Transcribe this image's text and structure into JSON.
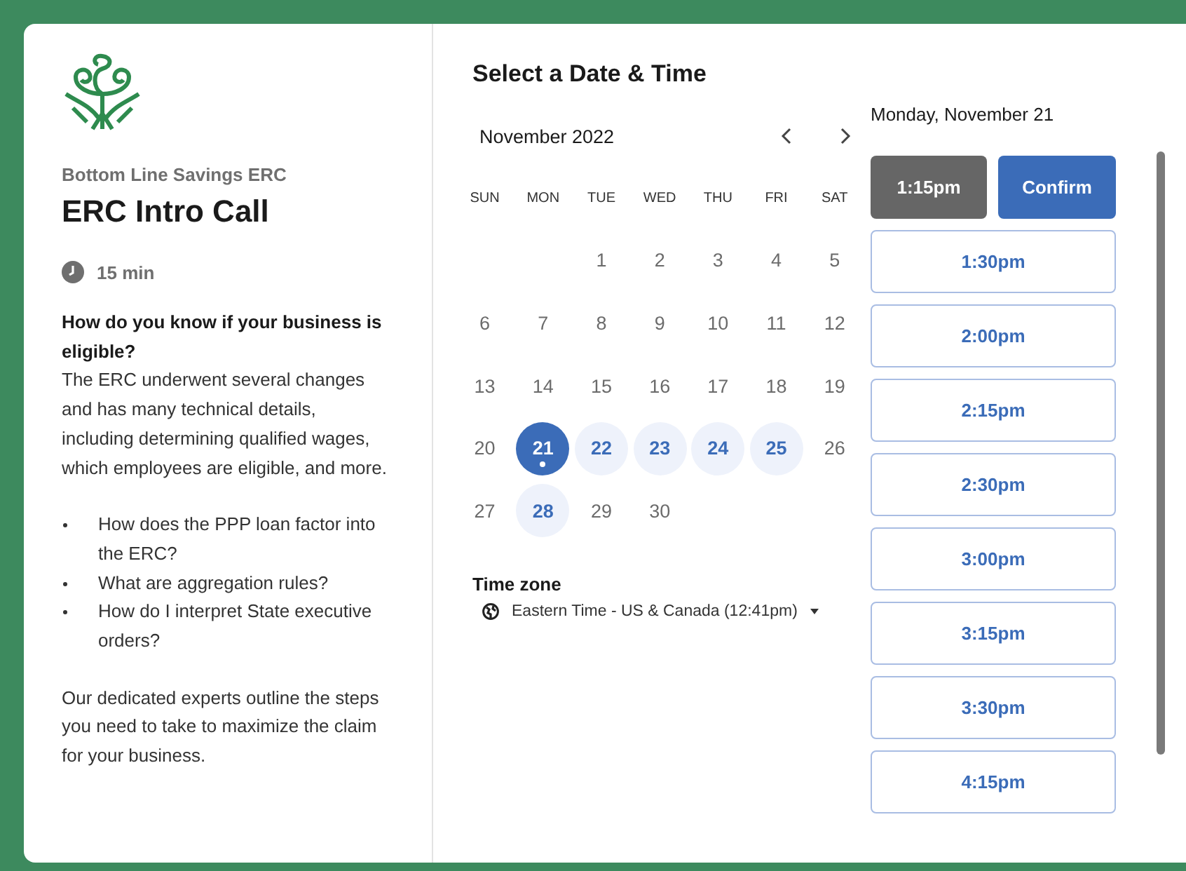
{
  "organizer": "Bottom Line Savings ERC",
  "event_title": "ERC Intro Call",
  "duration": "15 min",
  "description": {
    "heading": "How do you know if your business is eligible?",
    "intro": "The ERC underwent several changes and has many technical details, including determining qualified wages, which employees are eligible, and more.",
    "bullets": [
      "How does the PPP loan factor into the ERC?",
      "What are aggregation rules?",
      "How do I interpret State executive orders?"
    ],
    "closing": "Our dedicated experts outline the steps you need to take to maximize the claim for your business."
  },
  "scheduler": {
    "heading": "Select a Date & Time",
    "month": "November 2022",
    "weekdays": [
      "SUN",
      "MON",
      "TUE",
      "WED",
      "THU",
      "FRI",
      "SAT"
    ],
    "weeks": [
      [
        {
          "label": "1",
          "available": false,
          "selected": false,
          "today": false
        },
        {
          "label": "2",
          "available": false,
          "selected": false,
          "today": false
        },
        {
          "label": "3",
          "available": false,
          "selected": false,
          "today": false
        },
        {
          "label": "4",
          "available": false,
          "selected": false,
          "today": false
        },
        {
          "label": "5",
          "available": false,
          "selected": false,
          "today": false
        }
      ],
      [
        {
          "label": "6",
          "available": false,
          "selected": false,
          "today": false
        },
        {
          "label": "7",
          "available": false,
          "selected": false,
          "today": false
        },
        {
          "label": "8",
          "available": false,
          "selected": false,
          "today": false
        },
        {
          "label": "9",
          "available": false,
          "selected": false,
          "today": false
        },
        {
          "label": "10",
          "available": false,
          "selected": false,
          "today": false
        },
        {
          "label": "11",
          "available": false,
          "selected": false,
          "today": false
        },
        {
          "label": "12",
          "available": false,
          "selected": false,
          "today": false
        }
      ],
      [
        {
          "label": "13",
          "available": false,
          "selected": false,
          "today": false
        },
        {
          "label": "14",
          "available": false,
          "selected": false,
          "today": false
        },
        {
          "label": "15",
          "available": false,
          "selected": false,
          "today": false
        },
        {
          "label": "16",
          "available": false,
          "selected": false,
          "today": false
        },
        {
          "label": "17",
          "available": false,
          "selected": false,
          "today": false
        },
        {
          "label": "18",
          "available": false,
          "selected": false,
          "today": false
        },
        {
          "label": "19",
          "available": false,
          "selected": false,
          "today": false
        }
      ],
      [
        {
          "label": "20",
          "available": false,
          "selected": false,
          "today": false
        },
        {
          "label": "21",
          "available": true,
          "selected": true,
          "today": true
        },
        {
          "label": "22",
          "available": true,
          "selected": false,
          "today": false
        },
        {
          "label": "23",
          "available": true,
          "selected": false,
          "today": false
        },
        {
          "label": "24",
          "available": true,
          "selected": false,
          "today": false
        },
        {
          "label": "25",
          "available": true,
          "selected": false,
          "today": false
        },
        {
          "label": "26",
          "available": false,
          "selected": false,
          "today": false
        }
      ],
      [
        {
          "label": "27",
          "available": false,
          "selected": false,
          "today": false
        },
        {
          "label": "28",
          "available": true,
          "selected": false,
          "today": false
        },
        {
          "label": "29",
          "available": false,
          "selected": false,
          "today": false
        },
        {
          "label": "30",
          "available": false,
          "selected": false,
          "today": false
        }
      ]
    ],
    "timezone_label": "Time zone",
    "timezone": "Eastern Time - US & Canada (12:41pm)",
    "selected_date": "Monday, November 21",
    "confirm_label": "Confirm",
    "slots": [
      {
        "time": "1:15pm",
        "selected": true
      },
      {
        "time": "1:30pm",
        "selected": false
      },
      {
        "time": "2:00pm",
        "selected": false
      },
      {
        "time": "2:15pm",
        "selected": false
      },
      {
        "time": "2:30pm",
        "selected": false
      },
      {
        "time": "3:00pm",
        "selected": false
      },
      {
        "time": "3:15pm",
        "selected": false
      },
      {
        "time": "3:30pm",
        "selected": false
      },
      {
        "time": "4:15pm",
        "selected": false
      }
    ]
  }
}
